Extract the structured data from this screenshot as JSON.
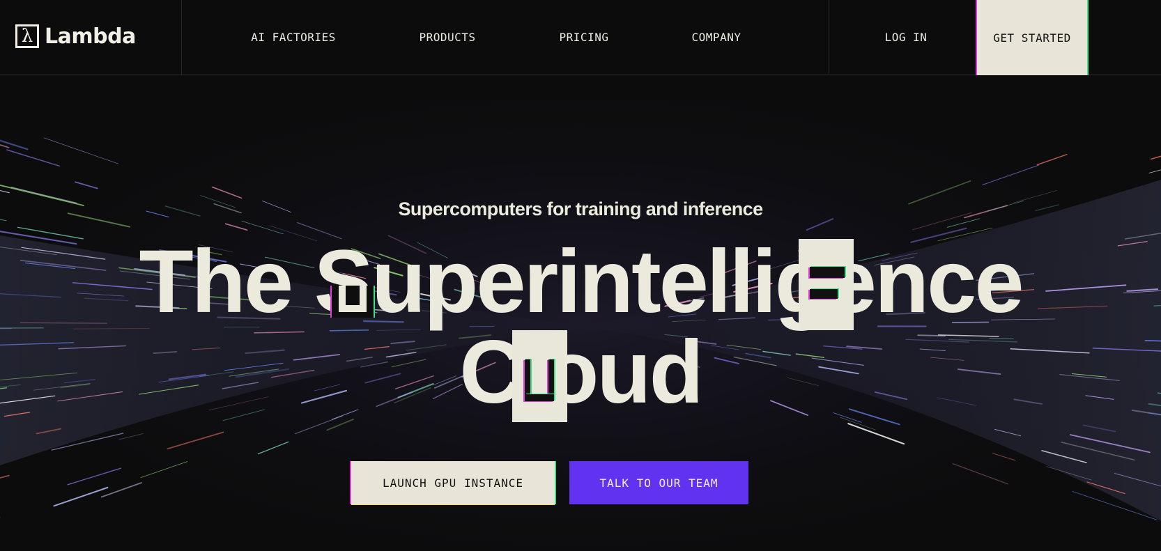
{
  "brand": {
    "logo_glyph": "λ",
    "name": "Lambda"
  },
  "nav": {
    "items": [
      {
        "label": "AI FACTORIES"
      },
      {
        "label": "PRODUCTS"
      },
      {
        "label": "PRICING"
      },
      {
        "label": "COMPANY"
      }
    ],
    "login_label": "LOG IN",
    "get_started_label": "GET STARTED"
  },
  "hero": {
    "subtitle": "Supercomputers for training and inference",
    "headline_line1": "The Superintelligence",
    "headline_line2": "Cloud",
    "primary_cta": "LAUNCH GPU INSTANCE",
    "secondary_cta": "TALK TO OUR TEAM"
  },
  "colors": {
    "background": "#0c0c0c",
    "text": "#ece9dd",
    "cta_primary_bg": "#e8e5d8",
    "cta_secondary_bg": "#6132f0",
    "glitch_magenta": "#e43ad8",
    "glitch_green": "#3ce28a"
  }
}
